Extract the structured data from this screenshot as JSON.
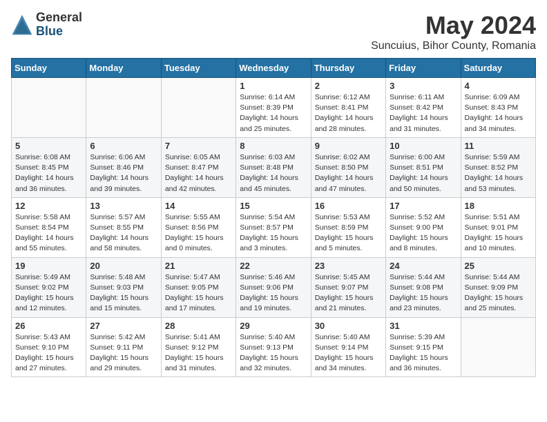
{
  "logo": {
    "general": "General",
    "blue": "Blue"
  },
  "title": {
    "month_year": "May 2024",
    "location": "Suncuius, Bihor County, Romania"
  },
  "weekdays": [
    "Sunday",
    "Monday",
    "Tuesday",
    "Wednesday",
    "Thursday",
    "Friday",
    "Saturday"
  ],
  "weeks": [
    [
      {
        "day": "",
        "info": ""
      },
      {
        "day": "",
        "info": ""
      },
      {
        "day": "",
        "info": ""
      },
      {
        "day": "1",
        "info": "Sunrise: 6:14 AM\nSunset: 8:39 PM\nDaylight: 14 hours\nand 25 minutes."
      },
      {
        "day": "2",
        "info": "Sunrise: 6:12 AM\nSunset: 8:41 PM\nDaylight: 14 hours\nand 28 minutes."
      },
      {
        "day": "3",
        "info": "Sunrise: 6:11 AM\nSunset: 8:42 PM\nDaylight: 14 hours\nand 31 minutes."
      },
      {
        "day": "4",
        "info": "Sunrise: 6:09 AM\nSunset: 8:43 PM\nDaylight: 14 hours\nand 34 minutes."
      }
    ],
    [
      {
        "day": "5",
        "info": "Sunrise: 6:08 AM\nSunset: 8:45 PM\nDaylight: 14 hours\nand 36 minutes."
      },
      {
        "day": "6",
        "info": "Sunrise: 6:06 AM\nSunset: 8:46 PM\nDaylight: 14 hours\nand 39 minutes."
      },
      {
        "day": "7",
        "info": "Sunrise: 6:05 AM\nSunset: 8:47 PM\nDaylight: 14 hours\nand 42 minutes."
      },
      {
        "day": "8",
        "info": "Sunrise: 6:03 AM\nSunset: 8:48 PM\nDaylight: 14 hours\nand 45 minutes."
      },
      {
        "day": "9",
        "info": "Sunrise: 6:02 AM\nSunset: 8:50 PM\nDaylight: 14 hours\nand 47 minutes."
      },
      {
        "day": "10",
        "info": "Sunrise: 6:00 AM\nSunset: 8:51 PM\nDaylight: 14 hours\nand 50 minutes."
      },
      {
        "day": "11",
        "info": "Sunrise: 5:59 AM\nSunset: 8:52 PM\nDaylight: 14 hours\nand 53 minutes."
      }
    ],
    [
      {
        "day": "12",
        "info": "Sunrise: 5:58 AM\nSunset: 8:54 PM\nDaylight: 14 hours\nand 55 minutes."
      },
      {
        "day": "13",
        "info": "Sunrise: 5:57 AM\nSunset: 8:55 PM\nDaylight: 14 hours\nand 58 minutes."
      },
      {
        "day": "14",
        "info": "Sunrise: 5:55 AM\nSunset: 8:56 PM\nDaylight: 15 hours\nand 0 minutes."
      },
      {
        "day": "15",
        "info": "Sunrise: 5:54 AM\nSunset: 8:57 PM\nDaylight: 15 hours\nand 3 minutes."
      },
      {
        "day": "16",
        "info": "Sunrise: 5:53 AM\nSunset: 8:59 PM\nDaylight: 15 hours\nand 5 minutes."
      },
      {
        "day": "17",
        "info": "Sunrise: 5:52 AM\nSunset: 9:00 PM\nDaylight: 15 hours\nand 8 minutes."
      },
      {
        "day": "18",
        "info": "Sunrise: 5:51 AM\nSunset: 9:01 PM\nDaylight: 15 hours\nand 10 minutes."
      }
    ],
    [
      {
        "day": "19",
        "info": "Sunrise: 5:49 AM\nSunset: 9:02 PM\nDaylight: 15 hours\nand 12 minutes."
      },
      {
        "day": "20",
        "info": "Sunrise: 5:48 AM\nSunset: 9:03 PM\nDaylight: 15 hours\nand 15 minutes."
      },
      {
        "day": "21",
        "info": "Sunrise: 5:47 AM\nSunset: 9:05 PM\nDaylight: 15 hours\nand 17 minutes."
      },
      {
        "day": "22",
        "info": "Sunrise: 5:46 AM\nSunset: 9:06 PM\nDaylight: 15 hours\nand 19 minutes."
      },
      {
        "day": "23",
        "info": "Sunrise: 5:45 AM\nSunset: 9:07 PM\nDaylight: 15 hours\nand 21 minutes."
      },
      {
        "day": "24",
        "info": "Sunrise: 5:44 AM\nSunset: 9:08 PM\nDaylight: 15 hours\nand 23 minutes."
      },
      {
        "day": "25",
        "info": "Sunrise: 5:44 AM\nSunset: 9:09 PM\nDaylight: 15 hours\nand 25 minutes."
      }
    ],
    [
      {
        "day": "26",
        "info": "Sunrise: 5:43 AM\nSunset: 9:10 PM\nDaylight: 15 hours\nand 27 minutes."
      },
      {
        "day": "27",
        "info": "Sunrise: 5:42 AM\nSunset: 9:11 PM\nDaylight: 15 hours\nand 29 minutes."
      },
      {
        "day": "28",
        "info": "Sunrise: 5:41 AM\nSunset: 9:12 PM\nDaylight: 15 hours\nand 31 minutes."
      },
      {
        "day": "29",
        "info": "Sunrise: 5:40 AM\nSunset: 9:13 PM\nDaylight: 15 hours\nand 32 minutes."
      },
      {
        "day": "30",
        "info": "Sunrise: 5:40 AM\nSunset: 9:14 PM\nDaylight: 15 hours\nand 34 minutes."
      },
      {
        "day": "31",
        "info": "Sunrise: 5:39 AM\nSunset: 9:15 PM\nDaylight: 15 hours\nand 36 minutes."
      },
      {
        "day": "",
        "info": ""
      }
    ]
  ]
}
